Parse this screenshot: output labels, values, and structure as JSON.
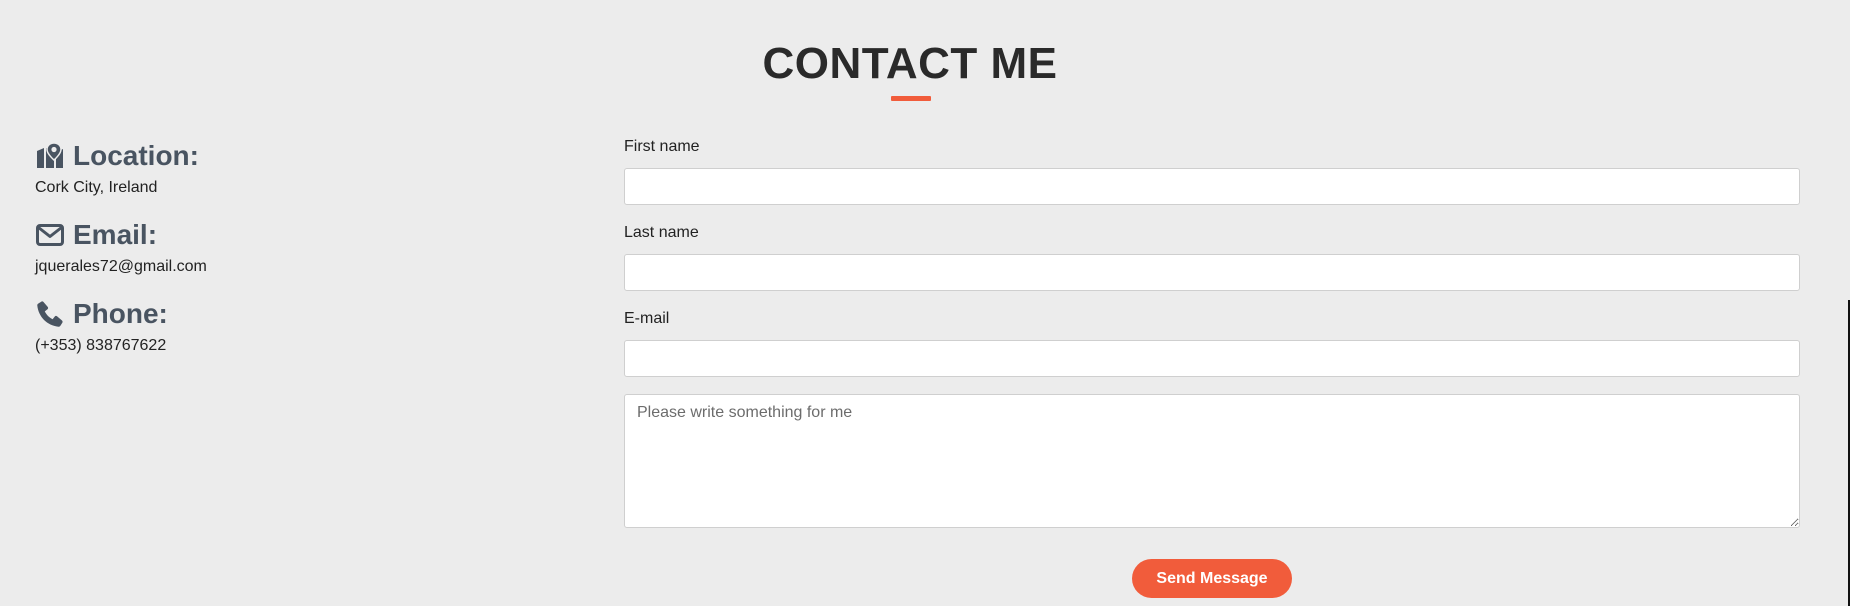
{
  "title": "CONTACT ME",
  "accent_color": "#f15c3b",
  "contact_info": [
    {
      "icon": "map-location-icon",
      "label": "Location:",
      "value": "Cork City, Ireland"
    },
    {
      "icon": "envelope-icon",
      "label": "Email:",
      "value": "jquerales72@gmail.com"
    },
    {
      "icon": "phone-icon",
      "label": "Phone:",
      "value": "(+353) 838767622"
    }
  ],
  "form": {
    "first_name_label": "First name",
    "first_name_value": "",
    "last_name_label": "Last name",
    "last_name_value": "",
    "email_label": "E-mail",
    "email_value": "",
    "message_placeholder": "Please write something for me",
    "message_value": "",
    "send_label": "Send Message"
  }
}
